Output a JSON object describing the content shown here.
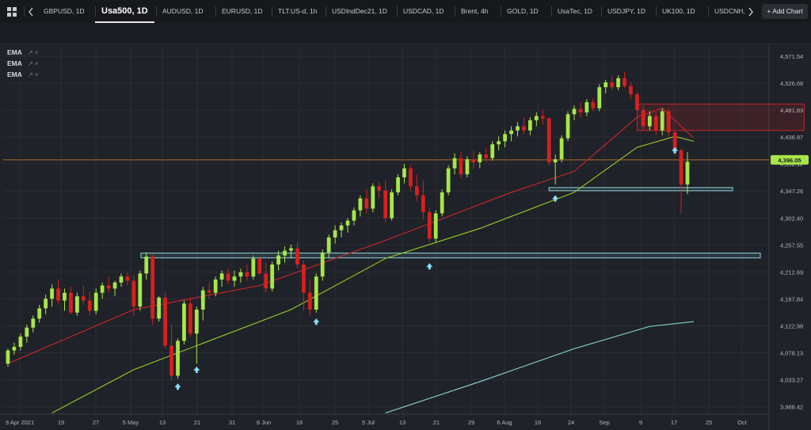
{
  "tabs": [
    {
      "label": "GBPUSD, 1D",
      "active": false
    },
    {
      "label": "Usa500, 1D",
      "active": true
    },
    {
      "label": "AUDUSD, 1D",
      "active": false
    },
    {
      "label": "EURUSD, 1D",
      "active": false
    },
    {
      "label": "TLT.US-d, 1h",
      "active": false
    },
    {
      "label": "USDIndDec21, 1D",
      "active": false
    },
    {
      "label": "USDCAD, 1D",
      "active": false
    },
    {
      "label": "Brent, 4h",
      "active": false
    },
    {
      "label": "GOLD, 1D",
      "active": false
    },
    {
      "label": "UsaTec, 1D",
      "active": false
    },
    {
      "label": "USDJPY, 1D",
      "active": false
    },
    {
      "label": "UK100, 1D",
      "active": false
    },
    {
      "label": "USDCNH,",
      "active": false
    }
  ],
  "add_chart_label": "+ Add Chart",
  "indicators": [
    {
      "name": "EMA",
      "controls": "↗ ×"
    },
    {
      "name": "EMA",
      "controls": "↗ ×"
    },
    {
      "name": "EMA",
      "controls": "↗ ×"
    }
  ],
  "toolbar_icons": [
    "circle-icon",
    "timer-icon",
    "gauge-icon",
    "half-circle-icon",
    "w-circle-icon",
    "ring-icon",
    "d-calendar-icon",
    "w-calendar-icon",
    "grid-calendar-icon",
    "dashboard-icon",
    "crosshair-icon",
    "pen-icon",
    "measure-icon"
  ],
  "colors": {
    "up": "#a7e64a",
    "down": "#d62020",
    "ema_fast": "#c0262c",
    "ema_mid": "#8fbe2b",
    "ema_slow": "#7bc8c8",
    "price_line": "#b36b2a",
    "zone": "#8fd3dc",
    "resistance": "#c0262c",
    "arrow": "#8ae0ff",
    "price_badge": "#a7e64a"
  },
  "chart_data": {
    "type": "candlestick",
    "symbol": "Usa500",
    "timeframe": "1D",
    "current_price": "4,396.05",
    "y_ticks": [
      "4,571.54",
      "4,526.68",
      "4,481.83",
      "4,436.97",
      "4,392.11",
      "4,347.26",
      "4,302.40",
      "4,257.55",
      "4,212.69",
      "4,167.84",
      "4,122.98",
      "4,078.13",
      "4,033.27",
      "3,988.42"
    ],
    "ylim": [
      3976,
      4586
    ],
    "x_ticks": [
      "9 Apr 2021",
      "19",
      "27",
      "5 May",
      "13",
      "21",
      "31",
      "8 Jun",
      "16",
      "25",
      "5 Jul",
      "13",
      "21",
      "29",
      "6 Aug",
      "16",
      "24",
      "Sep",
      "9",
      "17",
      "25",
      "Oct"
    ],
    "candles": [
      [
        4060,
        4085,
        4055,
        4082
      ],
      [
        4082,
        4095,
        4075,
        4088
      ],
      [
        4088,
        4110,
        4082,
        4105
      ],
      [
        4105,
        4125,
        4095,
        4120
      ],
      [
        4120,
        4140,
        4112,
        4135
      ],
      [
        4135,
        4158,
        4128,
        4152
      ],
      [
        4152,
        4175,
        4142,
        4168
      ],
      [
        4168,
        4192,
        4155,
        4185
      ],
      [
        4185,
        4200,
        4158,
        4165
      ],
      [
        4165,
        4185,
        4148,
        4178
      ],
      [
        4178,
        4188,
        4142,
        4145
      ],
      [
        4145,
        4178,
        4140,
        4172
      ],
      [
        4172,
        4190,
        4158,
        4165
      ],
      [
        4165,
        4180,
        4140,
        4148
      ],
      [
        4148,
        4185,
        4142,
        4178
      ],
      [
        4178,
        4195,
        4168,
        4190
      ],
      [
        4190,
        4205,
        4178,
        4185
      ],
      [
        4185,
        4198,
        4172,
        4195
      ],
      [
        4195,
        4210,
        4188,
        4205
      ],
      [
        4205,
        4212,
        4190,
        4198
      ],
      [
        4198,
        4208,
        4140,
        4155
      ],
      [
        4155,
        4215,
        4148,
        4210
      ],
      [
        4210,
        4245,
        4200,
        4238
      ],
      [
        4238,
        4242,
        4125,
        4135
      ],
      [
        4135,
        4172,
        4130,
        4170
      ],
      [
        4170,
        4178,
        4085,
        4090
      ],
      [
        4090,
        4125,
        4032,
        4040
      ],
      [
        4040,
        4102,
        4035,
        4098
      ],
      [
        4098,
        4165,
        4092,
        4160
      ],
      [
        4160,
        4170,
        4105,
        4110
      ],
      [
        4110,
        4155,
        4060,
        4150
      ],
      [
        4150,
        4188,
        4132,
        4182
      ],
      [
        4182,
        4195,
        4168,
        4178
      ],
      [
        4178,
        4205,
        4172,
        4200
      ],
      [
        4200,
        4215,
        4188,
        4210
      ],
      [
        4210,
        4218,
        4192,
        4198
      ],
      [
        4198,
        4215,
        4188,
        4205
      ],
      [
        4205,
        4218,
        4195,
        4212
      ],
      [
        4212,
        4225,
        4198,
        4205
      ],
      [
        4205,
        4240,
        4200,
        4235
      ],
      [
        4235,
        4240,
        4208,
        4210
      ],
      [
        4210,
        4228,
        4178,
        4185
      ],
      [
        4185,
        4230,
        4180,
        4225
      ],
      [
        4225,
        4248,
        4215,
        4240
      ],
      [
        4240,
        4255,
        4228,
        4248
      ],
      [
        4248,
        4258,
        4235,
        4252
      ],
      [
        4252,
        4262,
        4218,
        4225
      ],
      [
        4225,
        4232,
        4148,
        4178
      ],
      [
        4178,
        4200,
        4140,
        4150
      ],
      [
        4150,
        4210,
        4145,
        4205
      ],
      [
        4205,
        4250,
        4198,
        4245
      ],
      [
        4245,
        4275,
        4235,
        4270
      ],
      [
        4270,
        4290,
        4260,
        4282
      ],
      [
        4282,
        4295,
        4270,
        4290
      ],
      [
        4290,
        4302,
        4278,
        4298
      ],
      [
        4298,
        4320,
        4290,
        4315
      ],
      [
        4315,
        4340,
        4305,
        4335
      ],
      [
        4335,
        4350,
        4310,
        4318
      ],
      [
        4318,
        4360,
        4312,
        4355
      ],
      [
        4355,
        4362,
        4335,
        4348
      ],
      [
        4348,
        4365,
        4295,
        4302
      ],
      [
        4302,
        4350,
        4298,
        4345
      ],
      [
        4345,
        4375,
        4340,
        4370
      ],
      [
        4370,
        4392,
        4360,
        4385
      ],
      [
        4385,
        4390,
        4348,
        4355
      ],
      [
        4355,
        4375,
        4330,
        4340
      ],
      [
        4340,
        4365,
        4300,
        4312
      ],
      [
        4312,
        4320,
        4262,
        4268
      ],
      [
        4268,
        4315,
        4262,
        4310
      ],
      [
        4310,
        4350,
        4305,
        4345
      ],
      [
        4345,
        4390,
        4340,
        4385
      ],
      [
        4385,
        4410,
        4375,
        4402
      ],
      [
        4402,
        4412,
        4368,
        4375
      ],
      [
        4375,
        4405,
        4370,
        4400
      ],
      [
        4400,
        4415,
        4385,
        4395
      ],
      [
        4395,
        4412,
        4385,
        4408
      ],
      [
        4408,
        4420,
        4395,
        4402
      ],
      [
        4402,
        4430,
        4398,
        4425
      ],
      [
        4425,
        4438,
        4415,
        4430
      ],
      [
        4430,
        4448,
        4420,
        4442
      ],
      [
        4442,
        4455,
        4430,
        4448
      ],
      [
        4448,
        4462,
        4438,
        4455
      ],
      [
        4455,
        4470,
        4442,
        4448
      ],
      [
        4448,
        4470,
        4440,
        4465
      ],
      [
        4465,
        4478,
        4455,
        4472
      ],
      [
        4472,
        4482,
        4458,
        4468
      ],
      [
        4468,
        4470,
        4390,
        4395
      ],
      [
        4395,
        4408,
        4358,
        4400
      ],
      [
        4400,
        4440,
        4395,
        4435
      ],
      [
        4435,
        4480,
        4430,
        4475
      ],
      [
        4475,
        4490,
        4465,
        4484
      ],
      [
        4484,
        4495,
        4470,
        4478
      ],
      [
        4478,
        4500,
        4472,
        4495
      ],
      [
        4495,
        4502,
        4480,
        4485
      ],
      [
        4485,
        4525,
        4480,
        4520
      ],
      [
        4520,
        4532,
        4510,
        4528
      ],
      [
        4528,
        4540,
        4515,
        4520
      ],
      [
        4520,
        4540,
        4515,
        4535
      ],
      [
        4535,
        4545,
        4518,
        4522
      ],
      [
        4522,
        4528,
        4500,
        4508
      ],
      [
        4508,
        4512,
        4478,
        4482
      ],
      [
        4482,
        4490,
        4448,
        4455
      ],
      [
        4455,
        4480,
        4448,
        4472
      ],
      [
        4472,
        4478,
        4440,
        4448
      ],
      [
        4448,
        4485,
        4440,
        4480
      ],
      [
        4480,
        4485,
        4438,
        4445
      ],
      [
        4445,
        4448,
        4408,
        4415
      ],
      [
        4415,
        4418,
        4310,
        4358
      ],
      [
        4358,
        4412,
        4342,
        4396
      ]
    ],
    "ema_fast": [
      [
        0,
        4060
      ],
      [
        20,
        4150
      ],
      [
        40,
        4190
      ],
      [
        60,
        4265
      ],
      [
        80,
        4345
      ],
      [
        90,
        4380
      ],
      [
        100,
        4470
      ],
      [
        104,
        4485
      ],
      [
        108,
        4445
      ],
      [
        109,
        4436
      ]
    ],
    "ema_mid": [
      [
        7,
        3978
      ],
      [
        20,
        4050
      ],
      [
        30,
        4090
      ],
      [
        45,
        4150
      ],
      [
        60,
        4235
      ],
      [
        75,
        4285
      ],
      [
        90,
        4345
      ],
      [
        100,
        4420
      ],
      [
        106,
        4438
      ],
      [
        109,
        4430
      ]
    ],
    "ema_slow": [
      [
        60,
        3978
      ],
      [
        75,
        4030
      ],
      [
        90,
        4085
      ],
      [
        102,
        4122
      ],
      [
        109,
        4130
      ]
    ],
    "support_zones": [
      {
        "from": 28,
        "to": 149,
        "top": 4244,
        "bottom": 4236
      },
      {
        "from": 86,
        "to": 115,
        "top": 4353,
        "bottom": 4348
      }
    ],
    "resistance_zone": {
      "from": 100,
      "to": 119,
      "top": 4492,
      "bottom": 4448
    },
    "price_line": 4399,
    "signal_arrows": [
      {
        "i": 27,
        "v": 4022,
        "dir": "up"
      },
      {
        "i": 30,
        "v": 4050,
        "dir": "up"
      },
      {
        "i": 49,
        "v": 4130,
        "dir": "up"
      },
      {
        "i": 67,
        "v": 4222,
        "dir": "up"
      },
      {
        "i": 87,
        "v": 4335,
        "dir": "up"
      },
      {
        "i": 106,
        "v": 4415,
        "dir": "up"
      }
    ]
  }
}
